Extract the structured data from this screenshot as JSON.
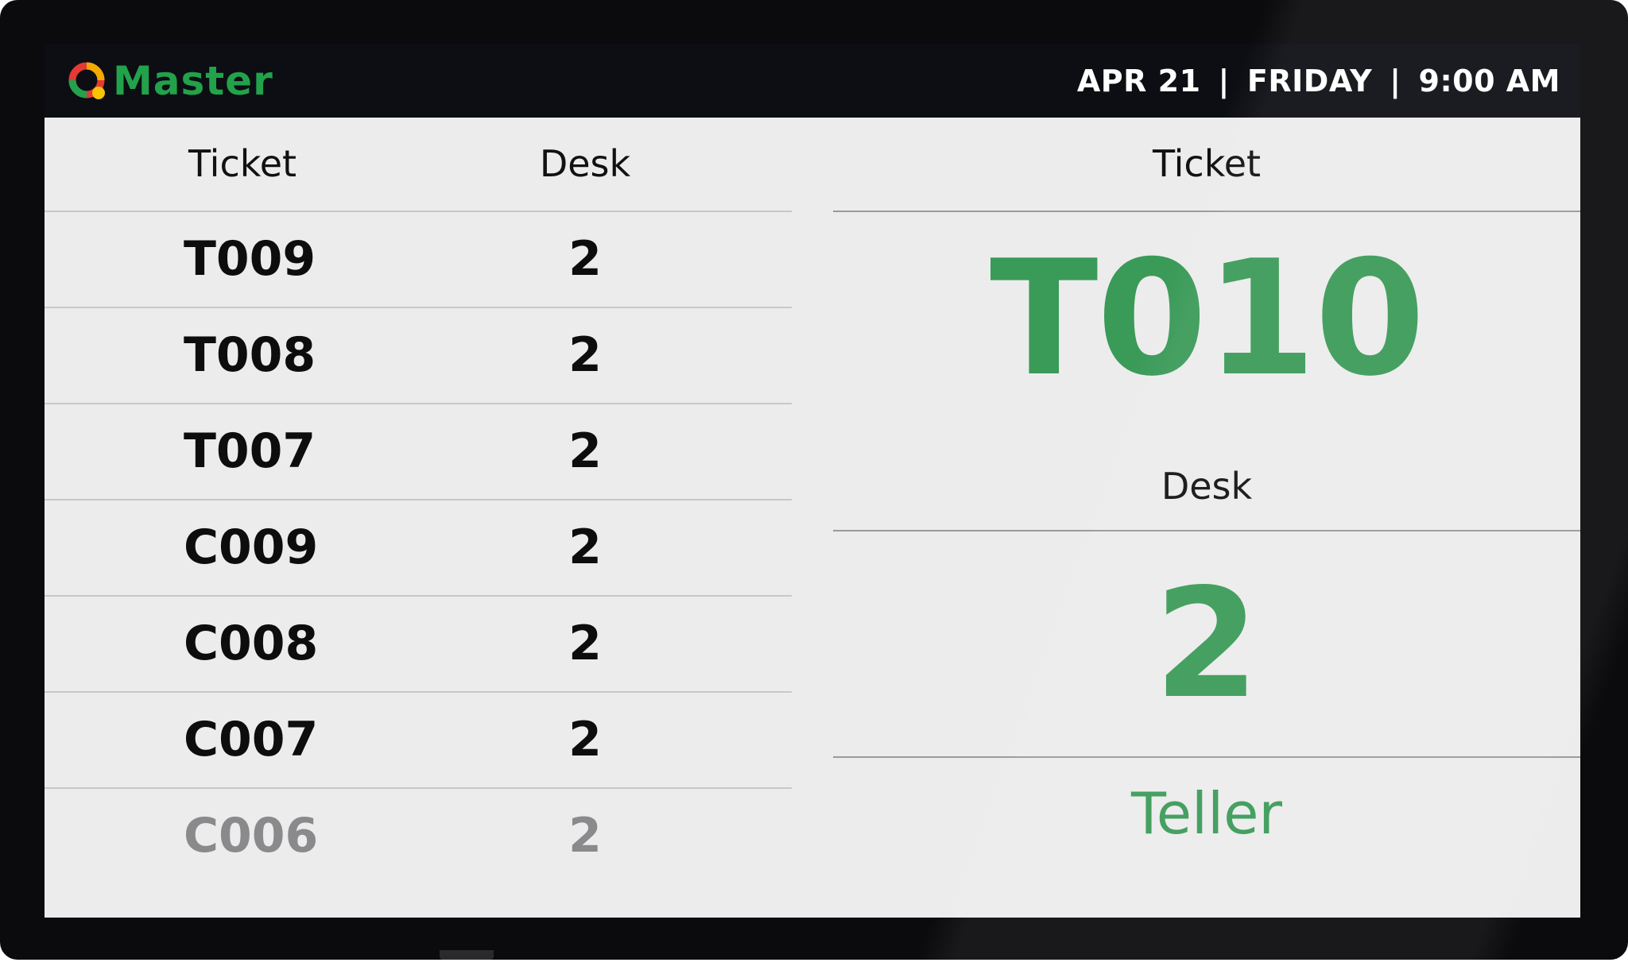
{
  "header": {
    "brand_name": "Master",
    "date": "APR 21",
    "day": "FRIDAY",
    "time": "9:00 AM",
    "separator": "|"
  },
  "history": {
    "columns": {
      "ticket": "Ticket",
      "desk": "Desk"
    },
    "rows": [
      {
        "ticket": "T009",
        "desk": "2"
      },
      {
        "ticket": "T008",
        "desk": "2"
      },
      {
        "ticket": "T007",
        "desk": "2"
      },
      {
        "ticket": "C009",
        "desk": "2"
      },
      {
        "ticket": "C008",
        "desk": "2"
      },
      {
        "ticket": "C007",
        "desk": "2"
      },
      {
        "ticket": "C006",
        "desk": "2"
      }
    ]
  },
  "current": {
    "ticket_label": "Ticket",
    "ticket": "T010",
    "desk_label": "Desk",
    "desk": "2",
    "service": "Teller"
  },
  "colors": {
    "brand_green": "#22a24a",
    "accent_green": "#3a9a58",
    "header_bg": "#0c0e14",
    "screen_bg": "#ececec"
  }
}
